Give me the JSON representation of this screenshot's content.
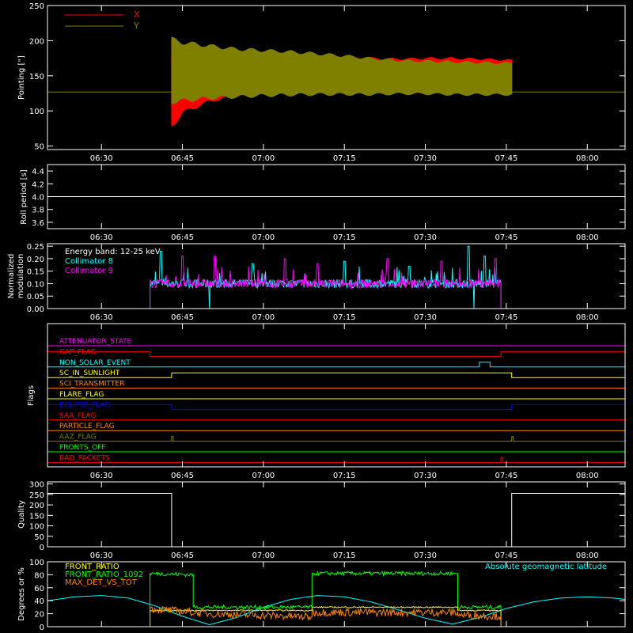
{
  "time_axis": {
    "start": "06:20",
    "end": "08:07",
    "ticks": [
      "06:30",
      "06:45",
      "07:00",
      "07:15",
      "07:30",
      "07:45",
      "08:00"
    ],
    "tick_minutes": [
      390,
      405,
      420,
      435,
      450,
      465,
      480
    ]
  },
  "chart_data": [
    {
      "id": "pointing",
      "type": "area",
      "ylabel": "Pointing [\"]",
      "ylim": [
        45,
        250
      ],
      "yticks": [
        50,
        100,
        150,
        200,
        250
      ],
      "legend": [
        {
          "name": "X",
          "color": "#ff0000"
        },
        {
          "name": "Y",
          "color": "#808000"
        }
      ],
      "baseline": 127,
      "active": [
        "06:43",
        "07:46"
      ],
      "series": [
        {
          "name": "X",
          "color": "#ff0000",
          "x": [
            "06:43",
            "06:45",
            "06:50",
            "06:55",
            "07:00",
            "07:05",
            "07:10",
            "07:15",
            "07:20",
            "07:25",
            "07:30",
            "07:35",
            "07:40",
            "07:46"
          ],
          "low": [
            75,
            95,
            112,
            120,
            124,
            127,
            128,
            130,
            130,
            131,
            132,
            132,
            132,
            133
          ],
          "high": [
            180,
            178,
            177,
            177,
            177,
            177,
            177,
            177,
            176,
            175,
            176,
            176,
            175,
            173
          ]
        },
        {
          "name": "Y",
          "color": "#808000",
          "x": [
            "06:43",
            "06:45",
            "06:50",
            "06:55",
            "07:00",
            "07:05",
            "07:10",
            "07:15",
            "07:20",
            "07:25",
            "07:30",
            "07:35",
            "07:40",
            "07:46"
          ],
          "low": [
            110,
            112,
            116,
            118,
            120,
            121,
            122,
            122,
            122,
            123,
            123,
            122,
            122,
            122
          ],
          "high": [
            205,
            200,
            195,
            190,
            188,
            186,
            183,
            180,
            176,
            173,
            172,
            171,
            170,
            169
          ]
        }
      ]
    },
    {
      "id": "roll",
      "type": "line",
      "ylabel": "Roll period [s]",
      "ylim": [
        3.5,
        4.5
      ],
      "yticks": [
        3.6,
        3.8,
        4.0,
        4.2,
        4.4
      ],
      "ytick_labels": [
        "3.6",
        "3.8",
        "4.0",
        "4.2",
        "4.4"
      ],
      "series": [
        {
          "x": [
            "06:20",
            "08:07"
          ],
          "y": [
            4.0,
            4.0
          ],
          "color": "#ffffff"
        }
      ]
    },
    {
      "id": "modulation",
      "type": "line",
      "ylabel": "Normalized modulation",
      "ylabel_lines": [
        "Normalized",
        "modulation"
      ],
      "ylim": [
        0,
        0.26
      ],
      "yticks": [
        0,
        0.05,
        0.1,
        0.15,
        0.2,
        0.25
      ],
      "ytick_labels": [
        "0.00",
        "0.05",
        "0.10",
        "0.15",
        "0.20",
        "0.25"
      ],
      "annotation": "Energy band: 12-25 keV",
      "active": [
        "06:39",
        "07:44"
      ],
      "series": [
        {
          "name": "Collimator 8",
          "color": "#00ffff",
          "level": 0.1,
          "spikes": [
            [
              "06:41",
              0.23
            ],
            [
              "06:58",
              0.18
            ],
            [
              "07:15",
              0.19
            ],
            [
              "07:27",
              0.17
            ],
            [
              "07:38",
              0.25
            ],
            [
              "07:41",
              0.21
            ]
          ],
          "dips": [
            "06:50",
            "07:39"
          ]
        },
        {
          "name": "Collimator 9",
          "color": "#ff00ff",
          "level": 0.1,
          "spikes": [
            [
              "06:45",
              0.21
            ],
            [
              "06:51",
              0.21
            ],
            [
              "07:04",
              0.2
            ],
            [
              "07:10",
              0.18
            ],
            [
              "07:23",
              0.2
            ],
            [
              "07:33",
              0.19
            ],
            [
              "07:43",
              0.2
            ]
          ],
          "dips": []
        }
      ]
    },
    {
      "id": "flags",
      "type": "line",
      "ylabel": "Flags",
      "flags": [
        {
          "name": "ATTENUATOR_STATE",
          "color": "#ff00ff",
          "on": []
        },
        {
          "name": "GAP_FLAG",
          "color": "#ff0000",
          "on": [
            [
              "06:20",
              "06:39"
            ],
            [
              "07:44",
              "08:07"
            ]
          ]
        },
        {
          "name": "NON_SOLAR_EVENT",
          "color": "#00ffff",
          "on": [
            [
              "07:40",
              "07:42"
            ]
          ]
        },
        {
          "name": "SC_IN_SUNLIGHT",
          "color": "#ffff00",
          "on": [
            [
              "06:43",
              "07:46"
            ]
          ]
        },
        {
          "name": "SCI_TRANSMITTER",
          "color": "#ff8800",
          "on": []
        },
        {
          "name": "FLARE_FLAG",
          "color": "#ffff00",
          "on": []
        },
        {
          "name": "ECLIPSE_FLAG",
          "color": "#0000ff",
          "on": [
            [
              "06:20",
              "06:43"
            ],
            [
              "07:46",
              "08:07"
            ]
          ]
        },
        {
          "name": "SAA_FLAG",
          "color": "#ff0000",
          "on": []
        },
        {
          "name": "PARTICLE_FLAG",
          "color": "#ff8800",
          "on": []
        },
        {
          "name": "AAZ_FLAG",
          "color": "#808000",
          "on": [
            [
              "06:43",
              "06:43"
            ],
            [
              "07:46",
              "07:46"
            ]
          ]
        },
        {
          "name": "FRONTS_OFF",
          "color": "#00ff00",
          "on": []
        },
        {
          "name": "BAD_PACKETS",
          "color": "#ff0000",
          "on": [
            [
              "07:44",
              "07:44"
            ]
          ]
        }
      ]
    },
    {
      "id": "quality",
      "type": "line",
      "ylabel": "Quality",
      "ylim": [
        0,
        310
      ],
      "yticks": [
        0,
        50,
        100,
        150,
        200,
        250,
        300
      ],
      "ytick_labels": [
        "0",
        "50",
        "100",
        "150",
        "200",
        "250",
        "300"
      ],
      "series": [
        {
          "color": "#ffffff",
          "x": [
            "06:20",
            "06:43",
            "06:43",
            "07:46",
            "07:46",
            "08:07"
          ],
          "y": [
            255,
            255,
            0,
            0,
            255,
            255
          ]
        }
      ]
    },
    {
      "id": "geomag",
      "type": "line",
      "ylabel": "Degrees or %",
      "ylim": [
        0,
        100
      ],
      "yticks": [
        0,
        20,
        40,
        60,
        80,
        100
      ],
      "ytick_labels": [
        "0",
        "20",
        "40",
        "60",
        "80",
        "100"
      ],
      "legend": [
        {
          "name": "FRONT_RATIO",
          "color": "#ffff00"
        },
        {
          "name": "FRONT_RATIO_1092",
          "color": "#00ff00"
        },
        {
          "name": "MAX_DET_VS_TOT",
          "color": "#ff8800"
        }
      ],
      "annotation": "Absolute geomagnetic latitude",
      "annotation_color": "#00ffff",
      "series": [
        {
          "name": "Absolute geomagnetic latitude",
          "color": "#00ffff",
          "x": [
            "06:20",
            "06:25",
            "06:30",
            "06:35",
            "06:40",
            "06:45",
            "06:50",
            "06:55",
            "07:00",
            "07:05",
            "07:10",
            "07:15",
            "07:20",
            "07:25",
            "07:30",
            "07:35",
            "07:40",
            "07:45",
            "07:50",
            "07:55",
            "08:00",
            "08:05",
            "08:07"
          ],
          "y": [
            40,
            46,
            48,
            44,
            32,
            16,
            3,
            14,
            30,
            42,
            48,
            46,
            38,
            26,
            13,
            4,
            14,
            28,
            38,
            44,
            46,
            44,
            42
          ]
        },
        {
          "name": "FRONT_RATIO_1092",
          "color": "#00ff00",
          "x": [
            "06:39",
            "06:39",
            "06:47",
            "06:47",
            "07:09",
            "07:09",
            "07:36",
            "07:36",
            "07:44",
            "07:44"
          ],
          "y": [
            0,
            82,
            80,
            30,
            30,
            82,
            82,
            30,
            30,
            0
          ],
          "noise": 3
        },
        {
          "name": "FRONT_RATIO",
          "color": "#ffff00",
          "x": [
            "06:39",
            "06:39",
            "07:09",
            "07:09",
            "07:36",
            "07:36",
            "07:44",
            "07:44"
          ],
          "y": [
            0,
            25,
            25,
            30,
            30,
            25,
            25,
            0
          ],
          "noise": 1
        },
        {
          "name": "MAX_DET_VS_TOT",
          "color": "#ff8800",
          "x": [
            "06:39",
            "06:39",
            "06:50",
            "07:09",
            "07:09",
            "07:36",
            "07:36",
            "07:44",
            "07:44"
          ],
          "y": [
            0,
            28,
            20,
            15,
            22,
            22,
            18,
            16,
            0
          ],
          "noise": 6
        }
      ]
    }
  ]
}
